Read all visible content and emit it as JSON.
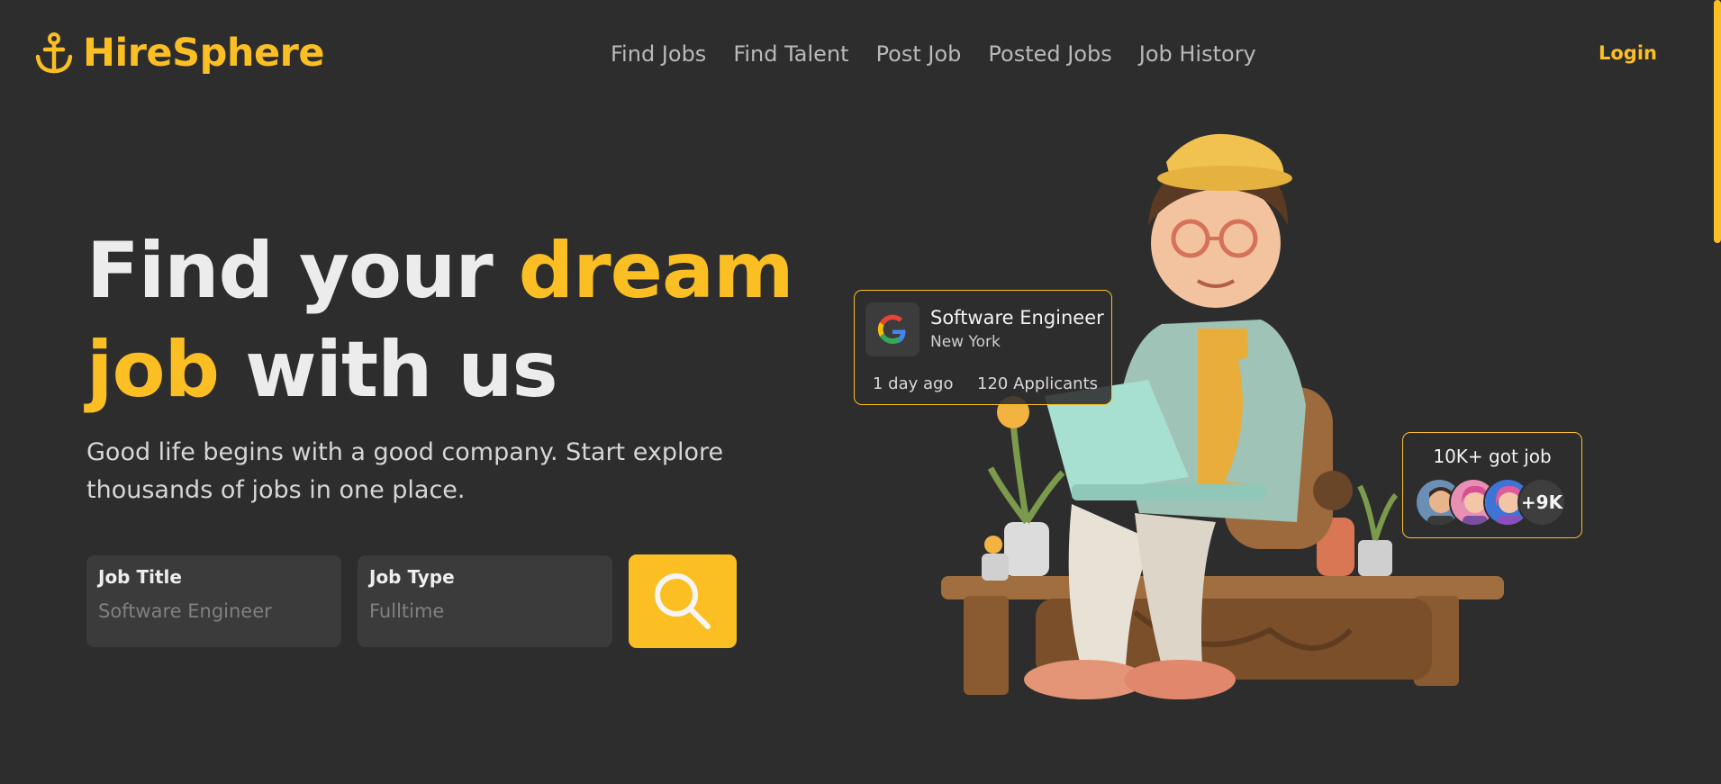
{
  "header": {
    "brand": "HireSphere",
    "nav": [
      "Find Jobs",
      "Find Talent",
      "Post Job",
      "Posted Jobs",
      "Job History"
    ],
    "login_label": "Login",
    "accent_color": "#fbbf24"
  },
  "hero": {
    "headline": {
      "part1": "Find your ",
      "highlight1": "dream",
      "highlight2": "job",
      "part2": " with us"
    },
    "subtext": "Good life begins with a good company. Start explore thousands of jobs in one place.",
    "search": {
      "job_title_label": "Job Title",
      "job_title_placeholder": "Software Engineer",
      "job_type_label": "Job Type",
      "job_type_placeholder": "Fulltime",
      "button_icon": "search-icon"
    }
  },
  "job_card": {
    "company_icon": "google-logo-icon",
    "title": "Software Engineer",
    "location": "New York",
    "posted": "1 day ago",
    "applicants": "120 Applicants"
  },
  "stats_card": {
    "title": "10K+ got job",
    "more_count": "+9K"
  }
}
